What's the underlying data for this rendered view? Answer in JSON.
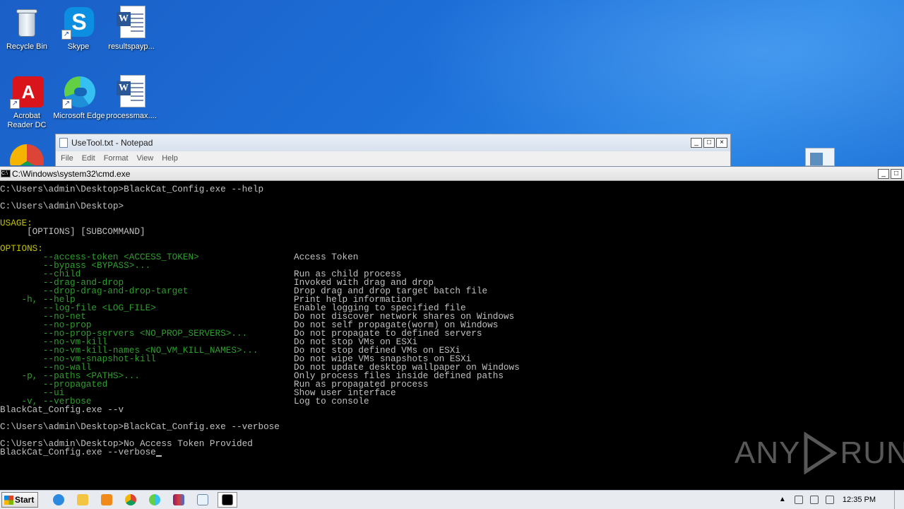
{
  "desktop": {
    "icons": [
      {
        "label": "Recycle Bin",
        "icon": "recycle-bin-icon"
      },
      {
        "label": "Skype",
        "icon": "skype-icon"
      },
      {
        "label": "resultspayp...",
        "icon": "word-document-icon"
      },
      {
        "label": "Acrobat Reader DC",
        "icon": "acrobat-icon"
      },
      {
        "label": "Microsoft Edge",
        "icon": "edge-icon"
      },
      {
        "label": "processmax....",
        "icon": "word-document-icon"
      }
    ]
  },
  "notepad": {
    "title": "UseTool.txt - Notepad",
    "menu": [
      "File",
      "Edit",
      "Format",
      "View",
      "Help"
    ],
    "buttons": {
      "minimize": "_",
      "maximize": "□",
      "close": "×"
    }
  },
  "cmd": {
    "title": "C:\\Windows\\system32\\cmd.exe",
    "buttons": {
      "minimize": "_",
      "maximize": "□"
    },
    "lines_before": [
      "C:\\Users\\admin\\Desktop>BlackCat_Config.exe --help",
      "",
      "C:\\Users\\admin\\Desktop>",
      ""
    ],
    "usage_header": "USAGE:",
    "usage_line": "     [OPTIONS] [SUBCOMMAND]",
    "options_header": "OPTIONS:",
    "options": [
      {
        "flag": "        --access-token <ACCESS_TOKEN>",
        "desc": "Access Token"
      },
      {
        "flag": "        --bypass <BYPASS>...",
        "desc": ""
      },
      {
        "flag": "        --child",
        "desc": "Run as child process"
      },
      {
        "flag": "        --drag-and-drop",
        "desc": "Invoked with drag and drop"
      },
      {
        "flag": "        --drop-drag-and-drop-target",
        "desc": "Drop drag and drop target batch file"
      },
      {
        "flag": "    -h, --help",
        "desc": "Print help information"
      },
      {
        "flag": "        --log-file <LOG_FILE>",
        "desc": "Enable logging to specified file"
      },
      {
        "flag": "        --no-net",
        "desc": "Do not discover network shares on Windows"
      },
      {
        "flag": "        --no-prop",
        "desc": "Do not self propagate(worm) on Windows"
      },
      {
        "flag": "        --no-prop-servers <NO_PROP_SERVERS>...",
        "desc": "Do not propagate to defined servers"
      },
      {
        "flag": "        --no-vm-kill",
        "desc": "Do not stop VMs on ESXi"
      },
      {
        "flag": "        --no-vm-kill-names <NO_VM_KILL_NAMES>...",
        "desc": "Do not stop defined VMs on ESXi"
      },
      {
        "flag": "        --no-vm-snapshot-kill",
        "desc": "Do not wipe VMs snapshots on ESXi"
      },
      {
        "flag": "        --no-wall",
        "desc": "Do not update desktop wallpaper on Windows"
      },
      {
        "flag": "    -p, --paths <PATHS>...",
        "desc": "Only process files inside defined paths"
      },
      {
        "flag": "        --propagated",
        "desc": "Run as propagated process"
      },
      {
        "flag": "        --ui",
        "desc": "Show user interface"
      },
      {
        "flag": "    -v, --verbose",
        "desc": "Log to console"
      }
    ],
    "lines_after": [
      "BlackCat_Config.exe --v",
      "",
      "C:\\Users\\admin\\Desktop>BlackCat_Config.exe --verbose",
      "",
      "C:\\Users\\admin\\Desktop>No Access Token Provided"
    ],
    "last_line": "BlackCat_Config.exe --verbose"
  },
  "watermark": {
    "left": "ANY",
    "right": "RUN"
  },
  "taskbar": {
    "start_label": "Start",
    "items": [
      "ie-icon",
      "explorer-icon",
      "media-player-icon",
      "chrome-icon",
      "edge-icon",
      "winrar-icon",
      "notepad-icon",
      "cmd-icon"
    ],
    "clock": "12:35 PM"
  }
}
